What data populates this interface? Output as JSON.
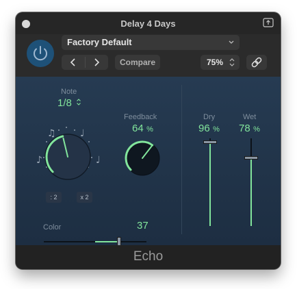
{
  "window": {
    "title": "Delay 4 Days"
  },
  "header": {
    "preset": "Factory Default",
    "compare_label": "Compare",
    "zoom": "75%"
  },
  "controls": {
    "note": {
      "label": "Note",
      "value": "1/8",
      "level": 0.45
    },
    "feedback": {
      "label": "Feedback",
      "value": "64",
      "unit": "%",
      "level": 0.64
    },
    "divide_label": ": 2",
    "multiply_label": "x 2",
    "color": {
      "label": "Color",
      "value": "37",
      "level": 0.73
    },
    "dry": {
      "label": "Dry",
      "value": "96",
      "unit": "%",
      "level": 0.96
    },
    "wet": {
      "label": "Wet",
      "value": "78",
      "unit": "%",
      "level": 0.78
    }
  },
  "footer": {
    "title": "Echo"
  },
  "colors": {
    "accent": "#82e59c",
    "power": "#1e5178",
    "panel": "#263b52"
  },
  "icons": [
    "close-icon",
    "window-icon",
    "power-icon",
    "chevron-left-icon",
    "chevron-right-icon",
    "chevron-updown-icon",
    "link-icon",
    "note-icon"
  ]
}
